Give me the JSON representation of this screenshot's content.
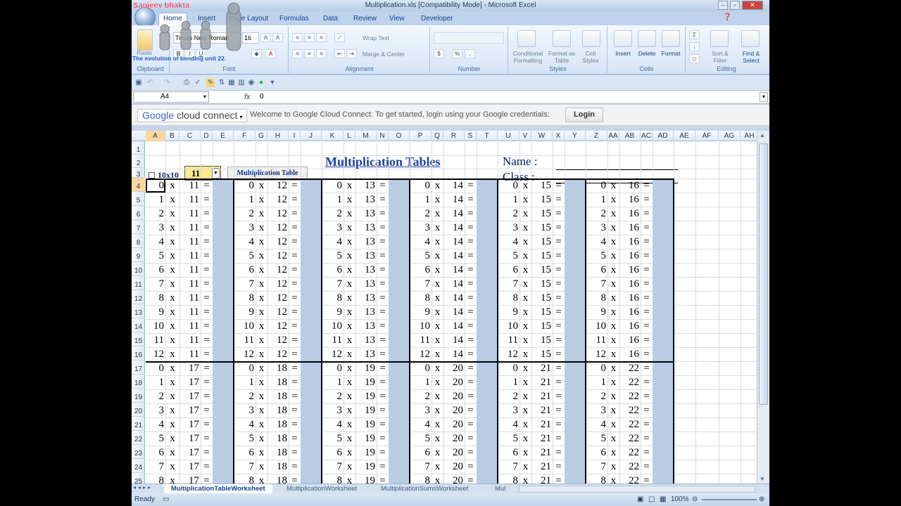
{
  "window": {
    "title": "Multiplication.xls  [Compatibility Mode] - Microsoft Excel"
  },
  "overlay": {
    "channel": "Sanjeev bhakta",
    "caption": "The evolution of bending unit 22."
  },
  "ribbon": {
    "tabs": [
      "Home",
      "Insert",
      "Page Layout",
      "Formulas",
      "Data",
      "Review",
      "View",
      "Developer"
    ],
    "font_name": "Times New Roman",
    "font_size": "16",
    "wrap_text": "Wrap Text",
    "merge_center": "Merge & Center",
    "conditional": "Conditional Formatting",
    "format_table": "Format as Table",
    "cell_styles": "Cell Styles",
    "insert": "Insert",
    "delete": "Delete",
    "format": "Format",
    "sort": "Sort & Filter",
    "find": "Find & Select",
    "groups": [
      "Clipboard",
      "Font",
      "Alignment",
      "Number",
      "Styles",
      "Cells",
      "Editing"
    ],
    "paste": "Paste"
  },
  "formula": {
    "namebox": "A4",
    "fx": "fx",
    "value": "0"
  },
  "gcc": {
    "logo_google": "Google",
    "logo_rest": " cloud connect",
    "message": "Welcome to Google Cloud Connect. To get started, login using your Google credentials:",
    "login": "Login"
  },
  "columns": [
    "A",
    "B",
    "C",
    "D",
    "E",
    "F",
    "G",
    "H",
    "I",
    "J",
    "K",
    "L",
    "M",
    "N",
    "O",
    "P",
    "Q",
    "R",
    "S",
    "T",
    "U",
    "V",
    "W",
    "X",
    "Y",
    "Z",
    "AA",
    "AB",
    "AC",
    "AD",
    "AE",
    "AF",
    "AG",
    "AH"
  ],
  "rows": [
    "1",
    "2",
    "3",
    "4",
    "5",
    "6",
    "7",
    "8",
    "9",
    "10",
    "11",
    "12",
    "13",
    "14",
    "15",
    "16",
    "17",
    "18",
    "19",
    "20",
    "21",
    "22",
    "23",
    "24",
    "25"
  ],
  "sheet": {
    "title": "Multiplication Tables",
    "name_label": "Name :",
    "class_label": "Class :",
    "checkbox_label": "10x10",
    "dropdown_value": "11",
    "button_label": "Multiplication Table",
    "x": "x",
    "eq": "=",
    "block1_tables": [
      11,
      12,
      13,
      14,
      15,
      16
    ],
    "block2_tables": [
      17,
      18,
      19,
      20,
      21,
      22
    ],
    "multipliers": [
      0,
      1,
      2,
      3,
      4,
      5,
      6,
      7,
      8,
      9,
      10,
      11,
      12
    ]
  },
  "sheet_tabs": [
    "MultiplicationTableWorksheet",
    "MultiplicationWorksheet",
    "MultiplicationSumsWorksheet",
    "Mul"
  ],
  "status": {
    "ready": "Ready",
    "zoom": "100%"
  }
}
